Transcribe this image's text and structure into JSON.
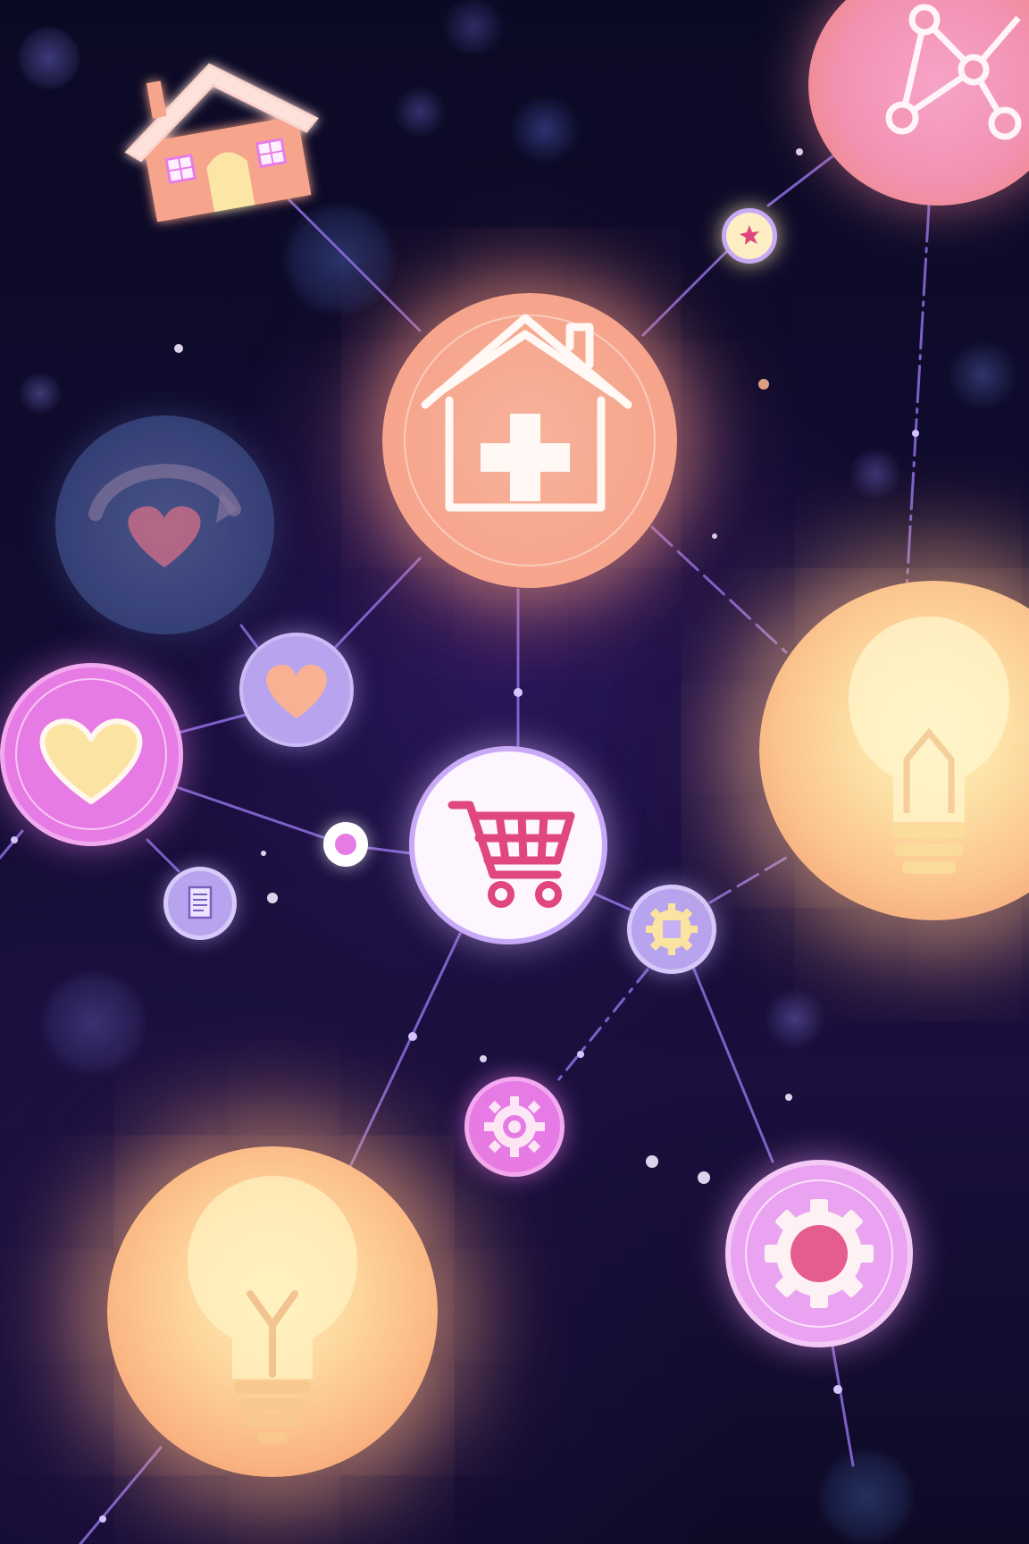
{
  "palette": {
    "background": "#0d0a26",
    "connector": "#8f6ee0",
    "peach": "#f6a58c",
    "pink": "#e77be6",
    "lavender": "#b8a4ee",
    "bulb_glow": "#ffd59a",
    "cream": "#fbe6a6",
    "white": "#fdf6ff",
    "cart_pink": "#e0467f"
  },
  "nodes": [
    {
      "name": "house-tile",
      "icon": "house-icon"
    },
    {
      "name": "network-node",
      "icon": "network-graph-icon"
    },
    {
      "name": "small-star-node",
      "icon": "star-icon"
    },
    {
      "name": "home-care-hub",
      "icon": "home-plus-icon"
    },
    {
      "name": "faded-heart-node",
      "icon": "heart-refresh-icon"
    },
    {
      "name": "heart-node-small",
      "icon": "heart-icon"
    },
    {
      "name": "heart-node-large",
      "icon": "heart-icon"
    },
    {
      "name": "document-node",
      "icon": "document-icon"
    },
    {
      "name": "shopping-cart-node",
      "icon": "shopping-cart-icon"
    },
    {
      "name": "chip-gear-node",
      "icon": "chip-icon"
    },
    {
      "name": "lightbulb-node-right",
      "icon": "lightbulb-icon"
    },
    {
      "name": "gear-node-small",
      "icon": "gear-icon"
    },
    {
      "name": "gear-node-large",
      "icon": "gear-icon"
    },
    {
      "name": "lightbulb-node-bottom",
      "icon": "lightbulb-icon"
    }
  ]
}
